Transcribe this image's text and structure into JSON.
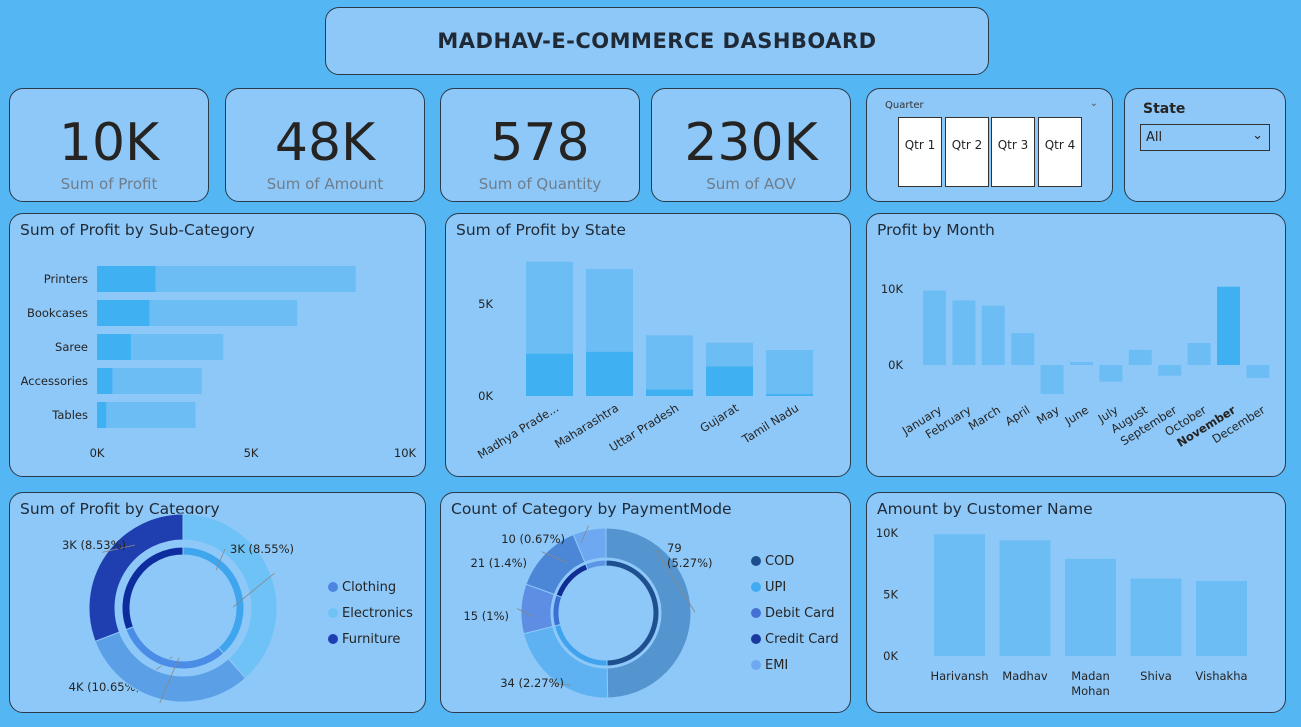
{
  "header": {
    "title": "MADHAV-E-COMMERCE DASHBOARD"
  },
  "kpis": [
    {
      "value": "10K",
      "label": "Sum of Profit"
    },
    {
      "value": "48K",
      "label": "Sum of Amount"
    },
    {
      "value": "578",
      "label": "Sum of Quantity"
    },
    {
      "value": "230K",
      "label": "Sum of AOV"
    }
  ],
  "quarter_slicer": {
    "label": "Quarter",
    "options": [
      "Qtr 1",
      "Qtr 2",
      "Qtr 3",
      "Qtr 4"
    ]
  },
  "state_slicer": {
    "label": "State",
    "value": "All"
  },
  "colors": {
    "background": "#55b6f4",
    "panel": "#8ec8f8",
    "bar_light": "#6dbdf5",
    "bar_dark": "#3fb1f3"
  },
  "chart_data": [
    {
      "id": "profit_subcat",
      "type": "bar",
      "orientation": "horizontal",
      "title": "Sum of Profit by Sub-Category",
      "categories": [
        "Printers",
        "Bookcases",
        "Saree",
        "Accessories",
        "Tables"
      ],
      "series": [
        {
          "values": [
            8400,
            6500,
            4100,
            3400,
            3200
          ]
        },
        {
          "values": [
            1900,
            1700,
            1100,
            500,
            300
          ]
        }
      ],
      "xlim": [
        0,
        10000
      ],
      "xticks": [
        "0K",
        "5K",
        "10K"
      ]
    },
    {
      "id": "profit_state",
      "type": "bar",
      "title": "Sum of Profit by State",
      "categories": [
        "Madhya Prade...",
        "Maharashtra",
        "Uttar Pradesh",
        "Gujarat",
        "Tamil Nadu"
      ],
      "series": [
        {
          "values": [
            7300,
            6900,
            3300,
            2900,
            2500
          ]
        },
        {
          "values": [
            2300,
            2400,
            350,
            1600,
            100
          ]
        }
      ],
      "ylim": [
        0,
        7500
      ],
      "yticks": [
        "0K",
        "5K"
      ]
    },
    {
      "id": "profit_month",
      "type": "bar",
      "title": "Profit by Month",
      "categories": [
        "January",
        "February",
        "March",
        "April",
        "May",
        "June",
        "July",
        "August",
        "September",
        "October",
        "November",
        "December"
      ],
      "values": [
        9800,
        8500,
        7800,
        4200,
        -3800,
        400,
        -2200,
        2000,
        -1400,
        2900,
        10300,
        -1700
      ],
      "highlight": "November",
      "ylim": [
        -4500,
        11000
      ],
      "yticks": [
        "0K",
        "10K"
      ]
    },
    {
      "id": "profit_category",
      "type": "pie",
      "donut": true,
      "title": "Sum of Profit by Category",
      "labels": [
        "Clothing",
        "Electronics",
        "Furniture"
      ],
      "values": [
        10.65,
        8.55,
        8.53
      ],
      "slice_labels": [
        "4K (10.65%)",
        "3K (8.55%)",
        "3K (8.53%)"
      ],
      "colors": [
        "#6fc2f6",
        "#5b9fe6",
        "#1f3fb0"
      ]
    },
    {
      "id": "payment_mode",
      "type": "pie",
      "donut": true,
      "title": "Count of Category by PaymentMode",
      "labels": [
        "COD",
        "UPI",
        "Debit Card",
        "Credit Card",
        "EMI"
      ],
      "values": [
        79,
        34,
        15,
        21,
        10
      ],
      "slice_labels": [
        "79 (5.27%)",
        "34 (2.27%)",
        "15 (1%)",
        "21 (1.4%)",
        "10 (0.67%)"
      ],
      "colors": [
        "#5494cf",
        "#5eb2f2",
        "#5d8ee3",
        "#4c86d6",
        "#6ea8f0"
      ]
    },
    {
      "id": "amount_customer",
      "type": "bar",
      "title": "Amount by Customer Name",
      "categories": [
        "Harivansh",
        "Madhav",
        "Madan Mohan",
        "Shiva",
        "Vishakha"
      ],
      "values": [
        9900,
        9400,
        7900,
        6300,
        6100
      ],
      "ylim": [
        0,
        10000
      ],
      "yticks": [
        "0K",
        "5K",
        "10K"
      ]
    }
  ]
}
